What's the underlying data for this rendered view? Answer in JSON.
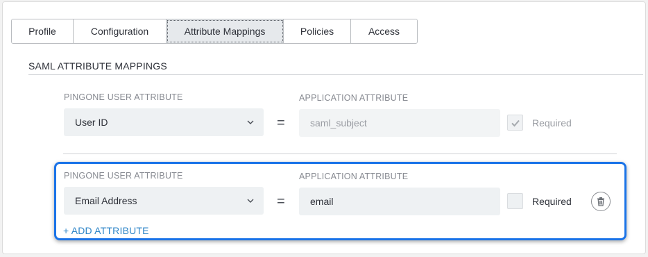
{
  "tabs": [
    {
      "label": "Profile"
    },
    {
      "label": "Configuration"
    },
    {
      "label": "Attribute Mappings",
      "active": true
    },
    {
      "label": "Policies"
    },
    {
      "label": "Access"
    }
  ],
  "section": {
    "title": "SAML ATTRIBUTE MAPPINGS"
  },
  "mappings": [
    {
      "user_attr_label": "PINGONE USER ATTRIBUTE",
      "user_attr_value": "User ID",
      "equals": "=",
      "app_attr_label": "APPLICATION ATTRIBUTE",
      "app_attr_value": "saml_subject",
      "required_checked": true,
      "required_disabled": true,
      "required_label": "Required"
    },
    {
      "user_attr_label": "PINGONE USER ATTRIBUTE",
      "user_attr_value": "Email Address",
      "equals": "=",
      "app_attr_label": "APPLICATION ATTRIBUTE",
      "app_attr_value": "email",
      "required_checked": false,
      "required_disabled": false,
      "required_label": "Required",
      "delete_icon": "trash-icon"
    }
  ],
  "add_attribute": {
    "label": "+ ADD ATTRIBUTE"
  },
  "colors": {
    "highlight": "#1a73e8",
    "link": "#2f86c8",
    "field_bg": "#eef1f3",
    "active_tab_bg": "#e6e9ec"
  }
}
